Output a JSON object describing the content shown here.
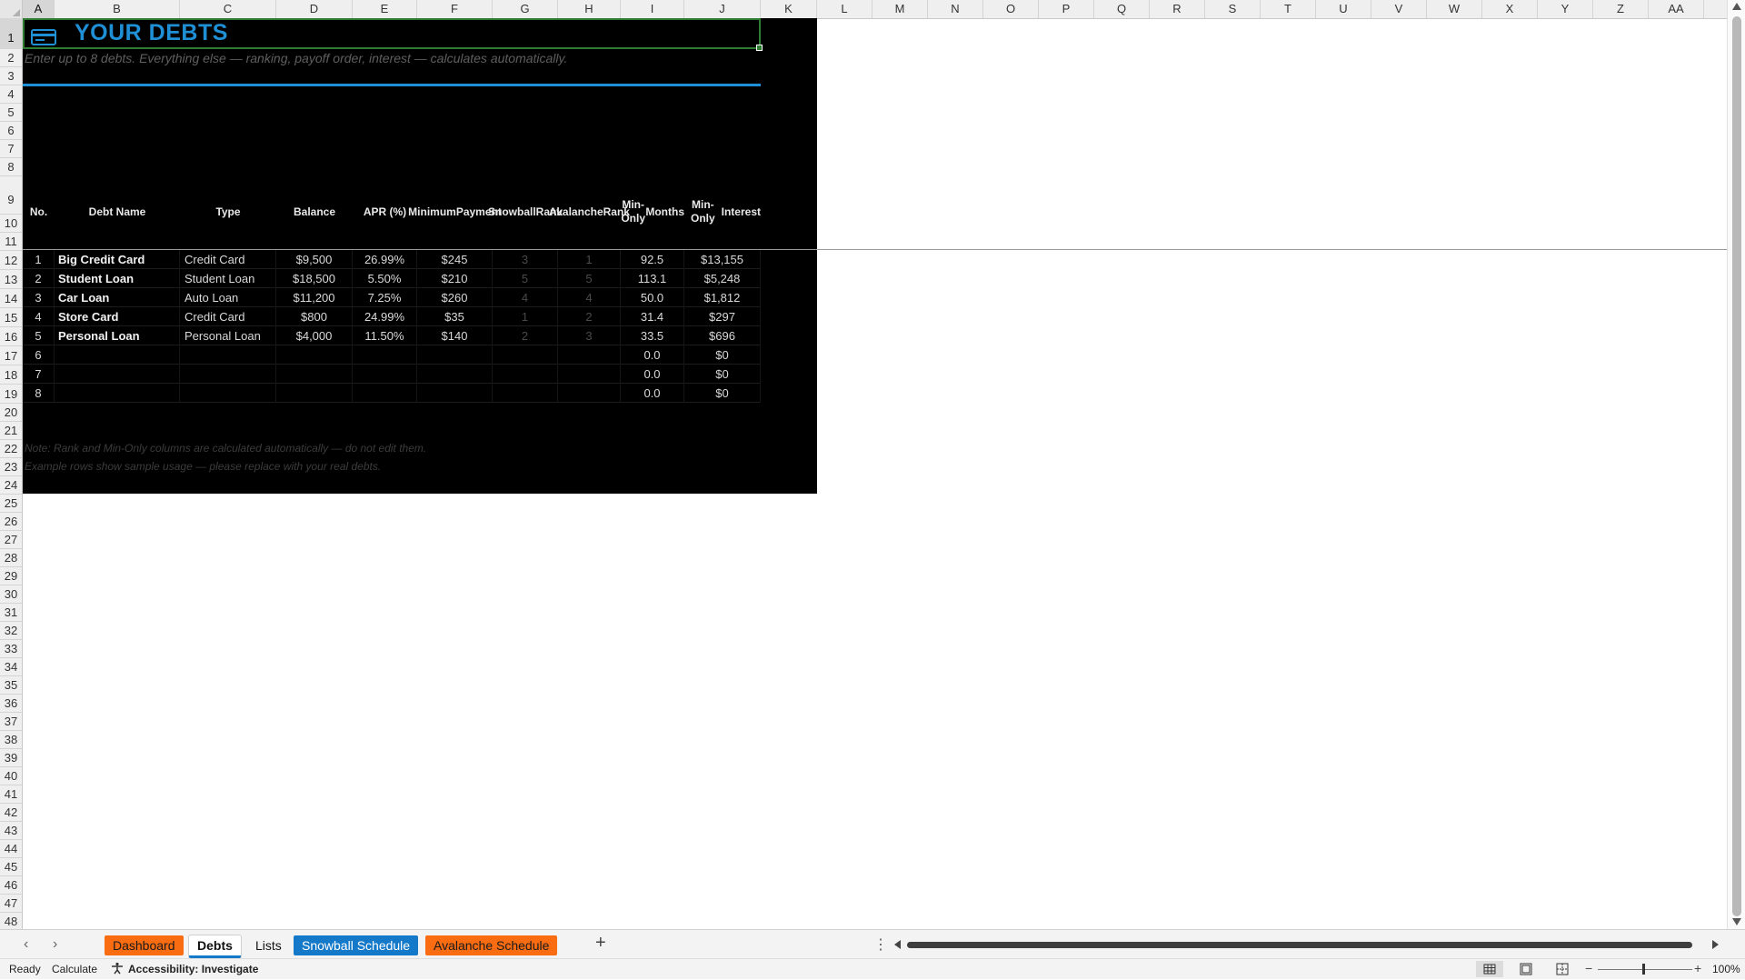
{
  "columns": [
    "A",
    "B",
    "C",
    "D",
    "E",
    "F",
    "G",
    "H",
    "I",
    "J",
    "K",
    "L",
    "M",
    "N",
    "O",
    "P",
    "Q",
    "R",
    "S",
    "T",
    "U",
    "V",
    "W",
    "X",
    "Y",
    "Z",
    "AA"
  ],
  "rows": [
    "1",
    "2",
    "3",
    "4",
    "5",
    "6",
    "7",
    "8",
    "9",
    "10",
    "11",
    "12",
    "13",
    "14",
    "15",
    "16",
    "17",
    "18",
    "19",
    "20",
    "21",
    "22",
    "23",
    "24",
    "25",
    "26",
    "27",
    "28",
    "29",
    "30",
    "31",
    "32",
    "33",
    "34",
    "35",
    "36",
    "37",
    "38",
    "39",
    "40",
    "41",
    "42",
    "43",
    "44",
    "45",
    "46",
    "47",
    "48"
  ],
  "sheet": {
    "title": "YOUR DEBTS",
    "subtitle": "Enter up to 8 debts. Everything else — ranking, payoff order, interest — calculates automatically.",
    "accent_color": "#1f8fd6",
    "headers": {
      "no": "No.",
      "name": "Debt Name",
      "type": "Type",
      "balance": "Balance",
      "apr": "APR (%)",
      "min_pay_1": "Minimum",
      "min_pay_2": "Payment",
      "snow_1": "Snowball",
      "snow_2": "Rank",
      "aval_1": "Avalanche",
      "aval_2": "Rank",
      "months_1": "Min-Only",
      "months_2": "Months",
      "interest_1": "Min-Only",
      "interest_2": "Interest"
    },
    "debts": [
      {
        "no": "1",
        "name": "Big Credit Card",
        "type": "Credit Card",
        "balance": "$9,500",
        "apr": "26.99%",
        "min": "$245",
        "snowball": "3",
        "avalanche": "1",
        "months": "92.5",
        "interest": "$13,155"
      },
      {
        "no": "2",
        "name": "Student Loan",
        "type": "Student Loan",
        "balance": "$18,500",
        "apr": "5.50%",
        "min": "$210",
        "snowball": "5",
        "avalanche": "5",
        "months": "113.1",
        "interest": "$5,248"
      },
      {
        "no": "3",
        "name": "Car Loan",
        "type": "Auto Loan",
        "balance": "$11,200",
        "apr": "7.25%",
        "min": "$260",
        "snowball": "4",
        "avalanche": "4",
        "months": "50.0",
        "interest": "$1,812"
      },
      {
        "no": "4",
        "name": "Store Card",
        "type": "Credit Card",
        "balance": "$800",
        "apr": "24.99%",
        "min": "$35",
        "snowball": "1",
        "avalanche": "2",
        "months": "31.4",
        "interest": "$297"
      },
      {
        "no": "5",
        "name": "Personal Loan",
        "type": "Personal Loan",
        "balance": "$4,000",
        "apr": "11.50%",
        "min": "$140",
        "snowball": "2",
        "avalanche": "3",
        "months": "33.5",
        "interest": "$696"
      },
      {
        "no": "6",
        "name": "",
        "type": "",
        "balance": "",
        "apr": "",
        "min": "",
        "snowball": "",
        "avalanche": "",
        "months": "0.0",
        "interest": "$0"
      },
      {
        "no": "7",
        "name": "",
        "type": "",
        "balance": "",
        "apr": "",
        "min": "",
        "snowball": "",
        "avalanche": "",
        "months": "0.0",
        "interest": "$0"
      },
      {
        "no": "8",
        "name": "",
        "type": "",
        "balance": "",
        "apr": "",
        "min": "",
        "snowball": "",
        "avalanche": "",
        "months": "0.0",
        "interest": "$0"
      }
    ],
    "note1": "Note: Rank and Min-Only columns are calculated automatically — do not edit them.",
    "note2": "Example rows show sample usage — please replace with your real debts."
  },
  "tabs": {
    "dashboard": "Dashboard",
    "debts": "Debts",
    "lists": "Lists",
    "snowball": "Snowball Schedule",
    "avalanche": "Avalanche Schedule",
    "add": "+",
    "tab_orange": "#f96c12",
    "tab_blue": "#1579c9"
  },
  "status": {
    "ready": "Ready",
    "calculate": "Calculate",
    "accessibility": "Accessibility: Investigate",
    "zoom": "100%"
  }
}
